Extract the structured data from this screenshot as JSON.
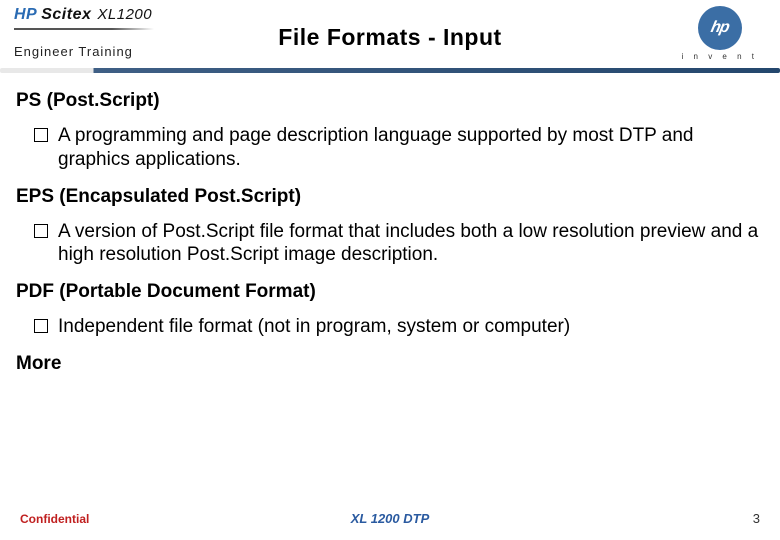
{
  "header": {
    "brand_hp": "HP",
    "brand_scitex": "Scitex",
    "brand_model": "XL1200",
    "subtitle": "Engineer  Training",
    "title": "File Formats - Input",
    "logo_letters": "hp",
    "logo_tagline": "i n v e n t"
  },
  "sections": [
    {
      "heading": "PS (Post.Script)",
      "bullet": "A programming and page description language supported by most DTP and graphics applications."
    },
    {
      "heading": "EPS (Encapsulated Post.Script)",
      "bullet": "A version of Post.Script file format that includes both a low resolution preview and a high resolution Post.Script image description."
    },
    {
      "heading": "PDF (Portable Document Format)",
      "bullet": "Independent file format (not in program, system or computer)"
    }
  ],
  "more_label": "More",
  "footer": {
    "confidential": "Confidential",
    "center": "XL 1200 DTP",
    "page": "3"
  }
}
